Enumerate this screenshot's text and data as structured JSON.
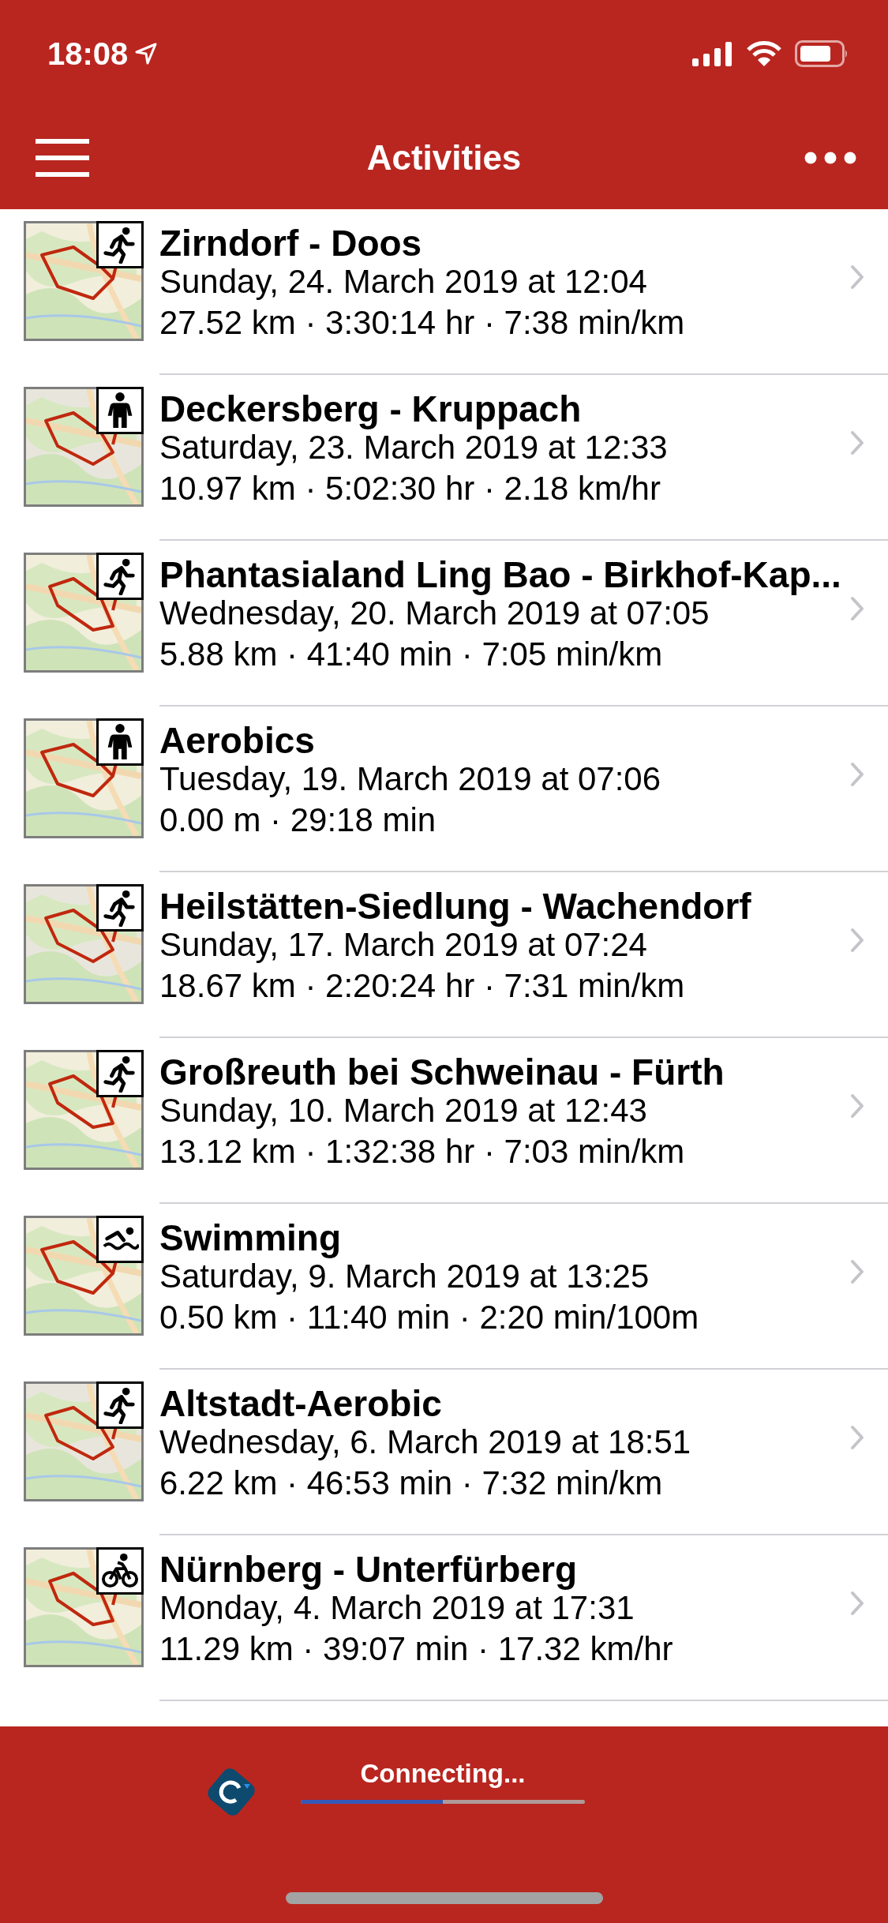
{
  "status_bar": {
    "time": "18:08"
  },
  "nav": {
    "title": "Activities"
  },
  "activities": [
    {
      "kind": "run",
      "title": "Zirndorf - Doos",
      "date": "Sunday, 24. March 2019 at 12:04",
      "stats": "27.52 km · 3:30:14 hr · 7:38 min/km"
    },
    {
      "kind": "walk",
      "title": "Deckersberg - Kruppach",
      "date": "Saturday, 23. March 2019 at 12:33",
      "stats": "10.97 km · 5:02:30 hr · 2.18 km/hr"
    },
    {
      "kind": "run",
      "title": "Phantasialand Ling Bao - Birkhof-Kap...",
      "date": "Wednesday, 20. March 2019 at 07:05",
      "stats": "5.88 km · 41:40 min · 7:05 min/km"
    },
    {
      "kind": "walk",
      "title": "Aerobics",
      "date": "Tuesday, 19. March 2019 at 07:06",
      "stats": "0.00 m · 29:18 min"
    },
    {
      "kind": "run",
      "title": "Heilstätten-Siedlung - Wachendorf",
      "date": "Sunday, 17. March 2019 at 07:24",
      "stats": "18.67 km · 2:20:24 hr · 7:31 min/km"
    },
    {
      "kind": "run",
      "title": "Großreuth bei Schweinau - Fürth",
      "date": "Sunday, 10. March 2019 at 12:43",
      "stats": "13.12 km · 1:32:38 hr · 7:03 min/km"
    },
    {
      "kind": "swim",
      "title": "Swimming",
      "date": "Saturday, 9. March 2019 at 13:25",
      "stats": "0.50 km · 11:40 min · 2:20 min/100m"
    },
    {
      "kind": "run",
      "title": "Altstadt-Aerobic",
      "date": "Wednesday, 6. March 2019 at 18:51",
      "stats": "6.22 km · 46:53 min · 7:32 min/km"
    },
    {
      "kind": "bike",
      "title": "Nürnberg - Unterfürberg",
      "date": "Monday, 4. March 2019 at 17:31",
      "stats": "11.29 km · 39:07 min · 17.32 km/hr"
    }
  ],
  "sync": {
    "label": "Connecting...",
    "level": 0.5
  }
}
